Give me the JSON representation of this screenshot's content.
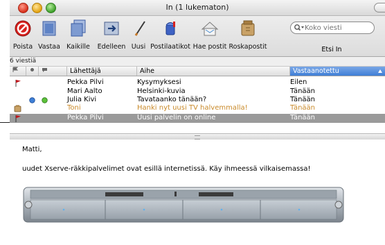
{
  "window": {
    "title": "In (1 lukematon)"
  },
  "toolbar": {
    "buttons": [
      {
        "label": "Poista",
        "icon": "delete-icon"
      },
      {
        "label": "Vastaa",
        "icon": "reply-icon"
      },
      {
        "label": "Kaikille",
        "icon": "reply-all-icon"
      },
      {
        "label": "Edelleen",
        "icon": "forward-icon"
      },
      {
        "label": "Uusi",
        "icon": "compose-icon"
      },
      {
        "label": "Postilaatikot",
        "icon": "mailboxes-icon"
      },
      {
        "label": "Hae postit",
        "icon": "get-mail-icon"
      },
      {
        "label": "Roskapostit",
        "icon": "junk-icon"
      }
    ],
    "search": {
      "placeholder": "Koko viesti",
      "label": "Etsi In"
    }
  },
  "status": {
    "text": "6 viestiä"
  },
  "columns": {
    "sender": "Lähettäjä",
    "subject": "Aihe",
    "date": "Vastaanotettu"
  },
  "messages": [
    {
      "sender": "Pekka Pilvi",
      "subject": "Kysymyksesi",
      "date": "Eilen",
      "flag": true
    },
    {
      "sender": "Mari Aalto",
      "subject": "Helsinki-kuvia",
      "date": "Tänään"
    },
    {
      "sender": "Julia Kivi",
      "subject": "Tavataanko tänään?",
      "date": "Tänään",
      "status": "online"
    },
    {
      "sender": "Toni",
      "subject": "Hanki nyt uusi TV halvemmalla!",
      "date": "Tänään",
      "junk": true
    },
    {
      "sender": "Pekka Pilvi",
      "subject": "Uusi palvelin on online",
      "date": "Tänään",
      "flag": true,
      "selected": true
    }
  ],
  "preview": {
    "greeting": "Matti,",
    "body": "uudet Xserve-räkkipalvelimet ovat esillä internetissä. Käy ihmeessä vilkaisemassa!"
  },
  "colors": {
    "selection": "#9a9a9a",
    "sorted_header": "#3f7ed6",
    "junk_text": "#c98a2a",
    "flag": "#c0161c"
  }
}
